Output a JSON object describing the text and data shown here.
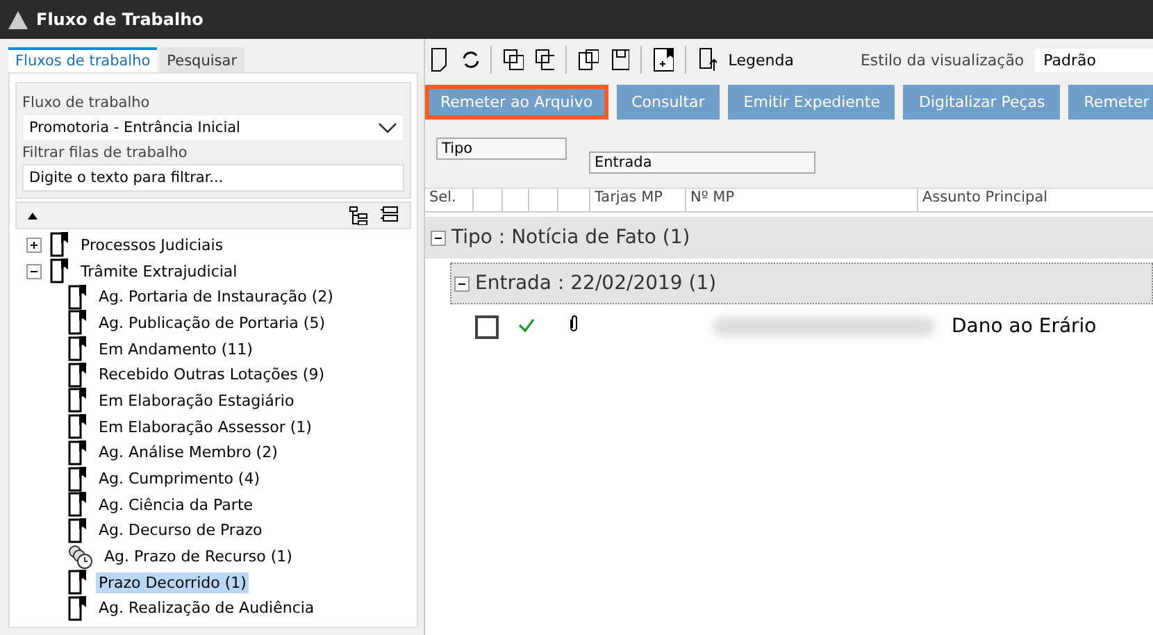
{
  "window": {
    "title": "Fluxo de Trabalho"
  },
  "left_tabs": [
    {
      "label": "Fluxos de trabalho",
      "selected": true
    },
    {
      "label": "Pesquisar",
      "selected": false
    }
  ],
  "workflow": {
    "label": "Fluxo de trabalho",
    "value": "Promotoria - Entrância Inicial"
  },
  "filter": {
    "label": "Filtrar filas de trabalho",
    "value": "Digite o texto para filtrar..."
  },
  "tree": [
    {
      "label": "Processos Judiciais",
      "kind": "doc",
      "expanded": false,
      "selected": false
    },
    {
      "label": "Trâmite Extrajudicial",
      "kind": "doc",
      "expanded": true,
      "selected": false,
      "children": [
        {
          "label": "Ag. Portaria de Instauração (2)",
          "kind": "doc",
          "selected": false
        },
        {
          "label": "Ag. Publicação de Portaria (5)",
          "kind": "doc",
          "selected": false
        },
        {
          "label": "Em Andamento (11)",
          "kind": "doc",
          "selected": false
        },
        {
          "label": "Recebido Outras Lotações (9)",
          "kind": "doc",
          "selected": false
        },
        {
          "label": "Em Elaboração Estagiário",
          "kind": "doc",
          "selected": false
        },
        {
          "label": "Em Elaboração Assessor (1)",
          "kind": "doc",
          "selected": false
        },
        {
          "label": "Ag. Análise Membro (2)",
          "kind": "doc",
          "selected": false
        },
        {
          "label": "Ag. Cumprimento (4)",
          "kind": "doc",
          "selected": false
        },
        {
          "label": "Ag. Ciência da Parte",
          "kind": "doc",
          "selected": false
        },
        {
          "label": "Ag. Decurso de Prazo",
          "kind": "doc",
          "selected": false
        },
        {
          "label": "Ag. Prazo de Recurso (1)",
          "kind": "clock",
          "selected": false
        },
        {
          "label": "Prazo Decorrido (1)",
          "kind": "doc",
          "selected": true
        },
        {
          "label": "Ag. Realização de Audiência",
          "kind": "doc",
          "selected": false
        }
      ]
    }
  ],
  "toolbar": {
    "legend": "Legenda",
    "style_label": "Estilo da visualização",
    "style_value": "Padrão"
  },
  "actions": [
    {
      "label": "Remeter ao Arquivo",
      "selected": true
    },
    {
      "label": "Consultar",
      "selected": false
    },
    {
      "label": "Emitir Expediente",
      "selected": false
    },
    {
      "label": "Digitalizar Peças",
      "selected": false
    },
    {
      "label": "Remeter",
      "selected": false
    }
  ],
  "group_by": [
    "Tipo",
    "Entrada"
  ],
  "columns": [
    "Sel.",
    "Tarjas MP",
    "Nº MP",
    "Assunto Principal"
  ],
  "groups": [
    {
      "label": "Tipo : Notícia de Fato  (1)",
      "children": [
        {
          "label": "Entrada : 22/02/2019  (1)",
          "rows": [
            {
              "checked": false,
              "ok": true,
              "attachment": true,
              "subject": "Dano ao Erário"
            }
          ]
        }
      ]
    }
  ]
}
